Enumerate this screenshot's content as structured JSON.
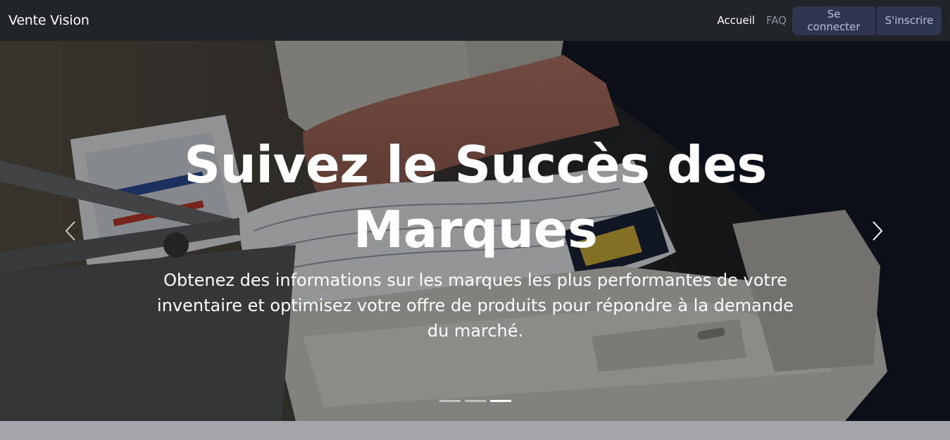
{
  "navbar": {
    "brand": "Vente Vision",
    "links": {
      "home": "Accueil",
      "faq": "FAQ"
    },
    "buttons": {
      "login": "Se connecter",
      "signup": "S'inscrire"
    }
  },
  "hero": {
    "title": "Suivez le Succès des Marques",
    "subtitle": "Obtenez des informations sur les marques les plus performantes de votre inventaire et optimisez votre offre de produits pour répondre à la demande du marché.",
    "indicators": {
      "count": 3,
      "active": 3
    }
  },
  "colors": {
    "navbar_bg": "#212529",
    "button_bg": "#2e3650",
    "page_bg": "#a4a4ab"
  },
  "icons": {
    "prev": "chevron-left-icon",
    "next": "chevron-right-icon"
  }
}
